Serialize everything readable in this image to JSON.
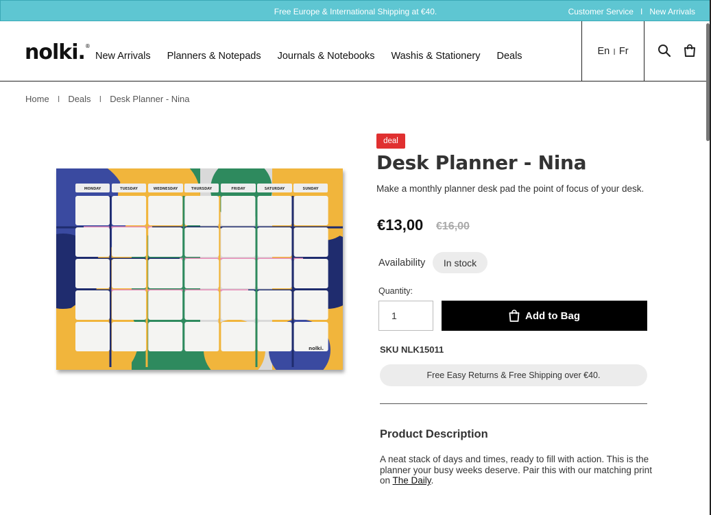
{
  "topbar": {
    "promo": "Free Europe & International Shipping at €40.",
    "customer_service": "Customer Service",
    "separator": "I",
    "new_arrivals": "New Arrivals"
  },
  "header": {
    "logo": "nolki",
    "nav": [
      "New Arrivals",
      "Planners & Notepads",
      "Journals & Notebooks",
      "Washis & Stationery",
      "Deals"
    ],
    "lang_en": "En",
    "lang_sep": "I",
    "lang_fr": "Fr",
    "icons": [
      "search-icon",
      "bag-icon"
    ]
  },
  "breadcrumb": [
    "Home",
    "Deals",
    "Desk Planner - Nina"
  ],
  "breadcrumb_sep": "I",
  "planner": {
    "days": [
      "MONDAY",
      "TUESDAY",
      "WEDNESDAY",
      "THURSDAY",
      "FRIDAY",
      "SATURDAY",
      "SUNDAY"
    ],
    "brand": "nolki."
  },
  "product": {
    "badge": "deal",
    "title": "Desk Planner - Nina",
    "description": "Make a monthly planner desk pad the point of focus of your desk.",
    "price": "€13,00",
    "old_price": "€16,00",
    "availability_label": "Availability",
    "availability": "In stock",
    "quantity_label": "Quantity:",
    "quantity": "1",
    "add_to_bag": "Add to Bag",
    "sku": "SKU NLK15011",
    "returns": "Free Easy Returns & Free Shipping over €40.",
    "desc_heading": "Product Description",
    "desc_text": "A neat stack of days and times, ready to fill with action. This is the planner your busy weeks deserve. Pair this with our matching print on ",
    "desc_link": "The Daily",
    "desc_end": "."
  },
  "colors": {
    "topbar": "#5ec6d2",
    "badge": "#e03030",
    "button": "#000000",
    "planner_navy": "#1f2c6e",
    "planner_yellow": "#f1b53c",
    "planner_green": "#2e8a5e",
    "planner_pink": "#e88cb8"
  }
}
